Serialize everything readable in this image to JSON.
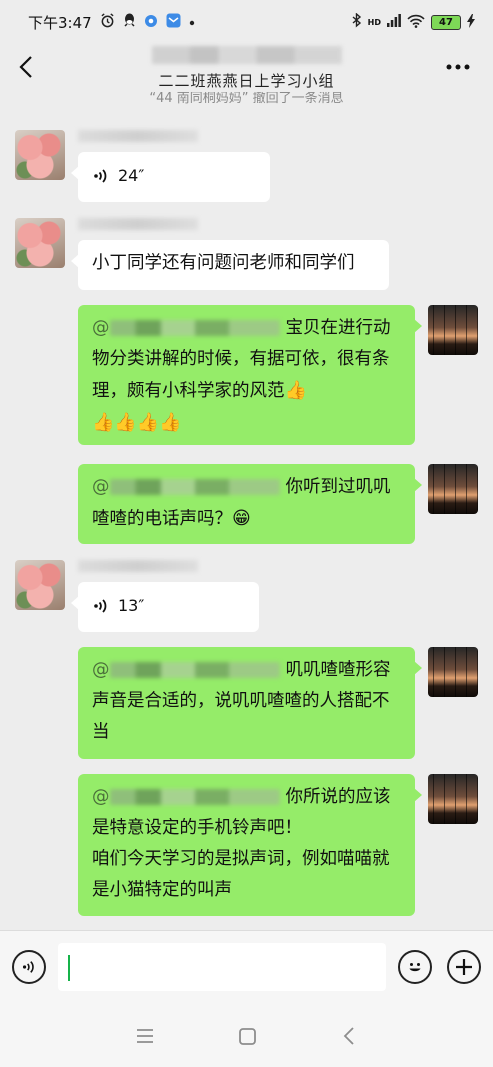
{
  "status_bar": {
    "time": "下午3:47",
    "signal": "HD",
    "battery": "47"
  },
  "header": {
    "title": "二二班燕燕日上学习小组"
  },
  "recall_notice": "“44 南同桐妈妈” 撤回了一条消息",
  "messages": [
    {
      "type": "voice",
      "side": "left",
      "duration": "24″"
    },
    {
      "type": "text",
      "side": "left",
      "text": "小丁同学还有问题问老师和同学们"
    },
    {
      "type": "text",
      "side": "right",
      "at": "@",
      "text": "宝贝在进行动物分类讲解的时候，有据可依，很有条理，颇有小科学家的风范"
    },
    {
      "type": "text",
      "side": "right",
      "at": "@",
      "text": "你听到过叽叽喳喳的电话声吗？"
    },
    {
      "type": "voice",
      "side": "left",
      "duration": "13″"
    },
    {
      "type": "text",
      "side": "right",
      "at": "@",
      "text": "叽叽喳喳形容声音是合适的，说叽叽喳喳的人搭配不当"
    },
    {
      "type": "text",
      "side": "right",
      "at": "@",
      "text": "你所说的应该是特意设定的手机铃声吧！",
      "text2": "咱们今天学习的是拟声词，例如喵喵就是小猫特定的叫声"
    }
  ],
  "emoji": {
    "thumbs": "👍",
    "grin": "😁"
  },
  "input": {
    "value": ""
  },
  "colors": {
    "chat_bg": "#ededed",
    "bubble_green": "#95ec69",
    "bubble_white": "#ffffff",
    "cursor": "#16b34a"
  }
}
